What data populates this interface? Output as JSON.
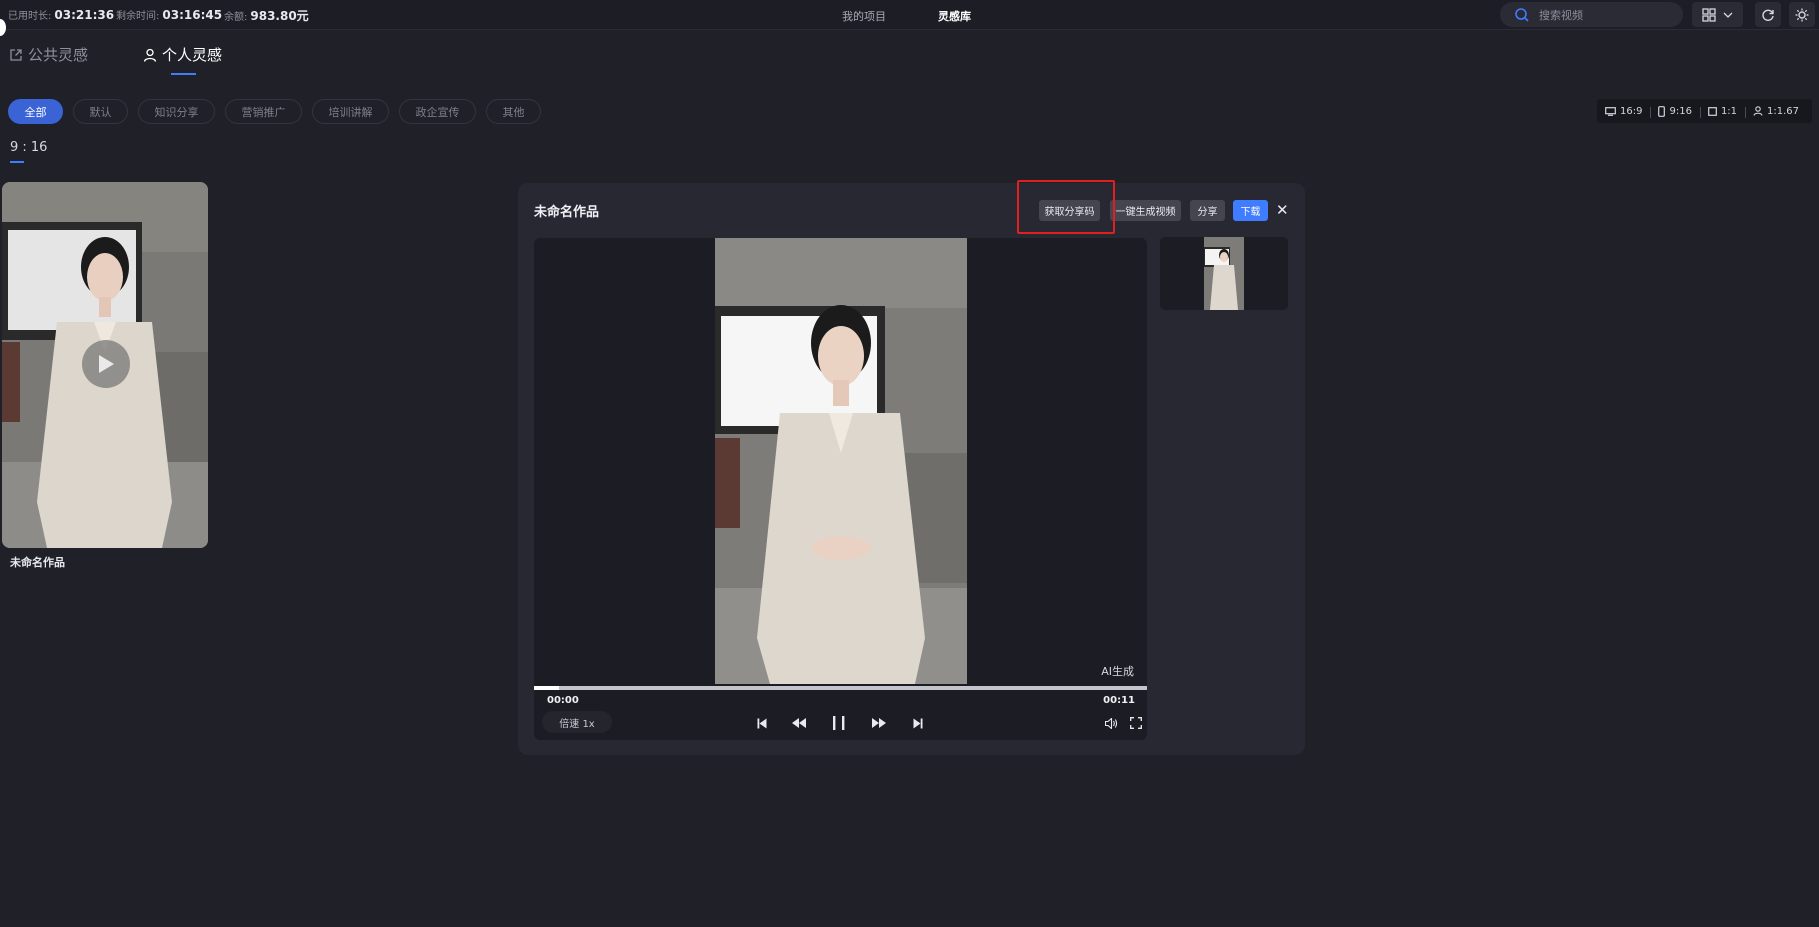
{
  "topbar": {
    "used_label": "已用时长:",
    "used_value": "03:21:36",
    "remaining_label": "剩余时间:",
    "remaining_value": "03:16:45",
    "balance_label": "余额:",
    "balance_value": "983.80元",
    "nav": [
      "我的项目",
      "灵感库"
    ],
    "active_nav": "灵感库",
    "search_placeholder": "搜索视频"
  },
  "tabs": [
    {
      "label": "公共灵感",
      "icon": "share-icon"
    },
    {
      "label": "个人灵感",
      "icon": "user-icon"
    }
  ],
  "active_tab": "个人灵感",
  "filters": [
    "全部",
    "默认",
    "知识分享",
    "营销推广",
    "培训讲解",
    "政企宣传",
    "其他"
  ],
  "active_filter": "全部",
  "ratios": [
    "16:9",
    "9:16",
    "1:1",
    "1:1.67"
  ],
  "section_label": "9 : 16",
  "card": {
    "title": "未命名作品",
    "icon": "play-icon"
  },
  "modal": {
    "title": "未命名作品",
    "buttons": {
      "share_code": "获取分享码",
      "generate_video": "一键生成视频",
      "share": "分享",
      "download": "下载"
    },
    "close": "✕",
    "ai_tag": "AI生成",
    "time_current": "00:00",
    "time_total": "00:11",
    "progress": 0.04,
    "speed": "倍速 1x"
  },
  "colors": {
    "accent": "#3f7cff",
    "highlight": "#e02020",
    "background": "#1f2028",
    "panel": "#272832"
  }
}
